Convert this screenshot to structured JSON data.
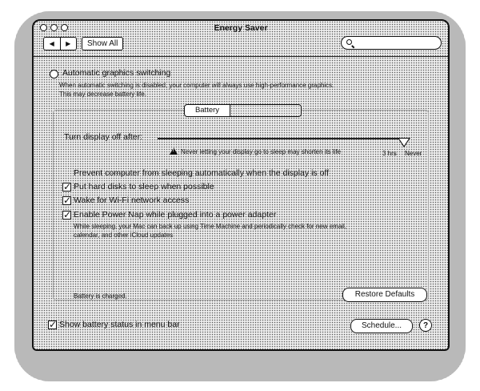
{
  "window": {
    "title": "Energy Saver"
  },
  "toolbar": {
    "back": "◀",
    "forward": "▶",
    "show_all": "Show All",
    "search_placeholder": ""
  },
  "graphics": {
    "label": "Automatic graphics switching",
    "note1": "When automatic switching is disabled, your computer will always use high-performance graphics.",
    "note2": "This may decrease battery life."
  },
  "tabs": [
    "Battery",
    ""
  ],
  "display": {
    "label": "Turn display off after:",
    "warning": "Never letting your display go to sleep may shorten its life",
    "tick_3hrs": "3 hrs",
    "tick_never": "Never",
    "slider_value": "Never"
  },
  "options": [
    {
      "label": "Prevent computer from sleeping automatically when the display is off",
      "checked": false
    },
    {
      "label": "Put hard disks to sleep when possible",
      "checked": true
    },
    {
      "label": "Wake for Wi-Fi network access",
      "checked": true
    },
    {
      "label": "Enable Power Nap while plugged into a power adapter",
      "checked": true
    }
  ],
  "powernap_note1": "While sleeping, your Mac can back up using Time Machine and periodically check for new email,",
  "powernap_note2": "calendar, and other iCloud updates",
  "battery_status": "Battery is charged.",
  "buttons": {
    "restore": "Restore Defaults",
    "schedule": "Schedule...",
    "help": "?"
  },
  "show_battery": {
    "label": "Show battery status in menu bar",
    "checked": true
  }
}
